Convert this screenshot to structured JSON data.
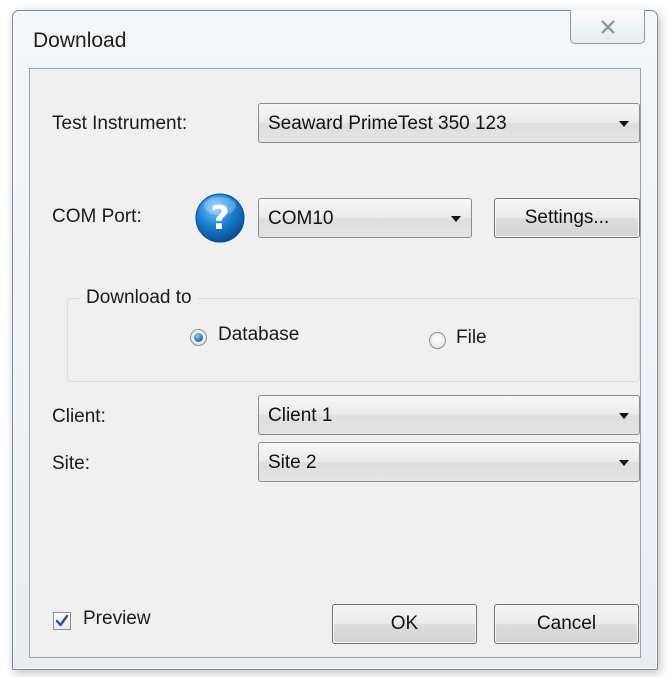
{
  "window": {
    "title": "Download"
  },
  "form": {
    "test_instrument_label": "Test Instrument:",
    "test_instrument_value": "Seaward PrimeTest 350 123",
    "com_port_label": "COM Port:",
    "com_port_value": "COM10",
    "settings_button": "Settings...",
    "download_to_label": "Download to",
    "download_to_options": [
      {
        "label": "Database",
        "selected": true
      },
      {
        "label": "File",
        "selected": false
      }
    ],
    "client_label": "Client:",
    "client_value": "Client 1",
    "site_label": "Site:",
    "site_value": "Site 2"
  },
  "footer": {
    "preview_label": "Preview",
    "preview_checked": true,
    "ok_button": "OK",
    "cancel_button": "Cancel"
  },
  "icons": {
    "close": "close-icon",
    "help": "help-icon",
    "dropdown": "chevron-down-icon",
    "check": "check-icon"
  },
  "colors": {
    "help_icon_blue": "#1a7fd0",
    "radio_selected": "#2a7bc9",
    "checkmark": "#2b4fa8"
  }
}
